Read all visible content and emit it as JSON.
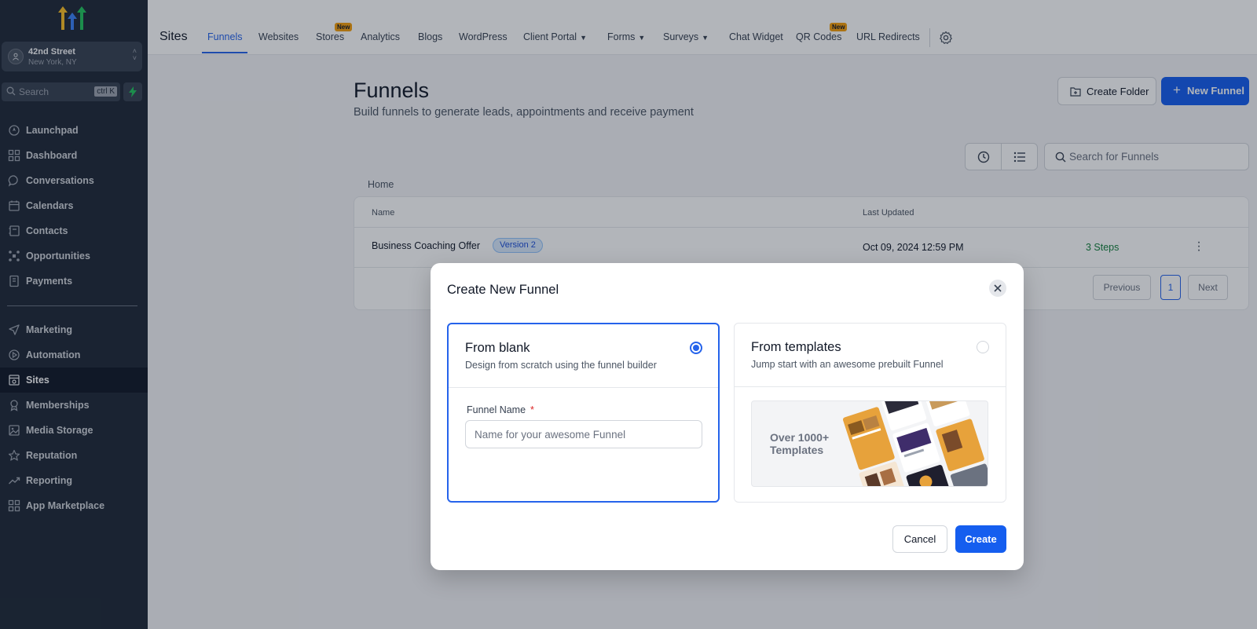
{
  "sidebar": {
    "location": {
      "name": "42nd Street",
      "city": "New York, NY"
    },
    "search": {
      "placeholder": "Search",
      "shortcut": "ctrl K"
    },
    "items": [
      {
        "label": "Launchpad",
        "icon": "launchpad-icon"
      },
      {
        "label": "Dashboard",
        "icon": "dashboard-icon"
      },
      {
        "label": "Conversations",
        "icon": "chat-icon"
      },
      {
        "label": "Calendars",
        "icon": "calendar-icon"
      },
      {
        "label": "Contacts",
        "icon": "contacts-icon"
      },
      {
        "label": "Opportunities",
        "icon": "opportunities-icon"
      },
      {
        "label": "Payments",
        "icon": "payments-icon"
      },
      {
        "label": "Marketing",
        "icon": "send-icon"
      },
      {
        "label": "Automation",
        "icon": "automation-icon"
      },
      {
        "label": "Sites",
        "icon": "sites-icon",
        "active": true
      },
      {
        "label": "Memberships",
        "icon": "award-icon"
      },
      {
        "label": "Media Storage",
        "icon": "image-icon"
      },
      {
        "label": "Reputation",
        "icon": "star-icon"
      },
      {
        "label": "Reporting",
        "icon": "trend-icon"
      },
      {
        "label": "App Marketplace",
        "icon": "grid-icon"
      }
    ]
  },
  "topbar": {
    "title": "Sites",
    "tabs": [
      {
        "label": "Funnels",
        "active": true
      },
      {
        "label": "Websites"
      },
      {
        "label": "Stores",
        "badge": "New"
      },
      {
        "label": "Analytics"
      },
      {
        "label": "Blogs"
      },
      {
        "label": "WordPress"
      },
      {
        "label": "Client Portal",
        "dropdown": true
      },
      {
        "label": "Forms",
        "dropdown": true
      },
      {
        "label": "Surveys",
        "dropdown": true
      },
      {
        "label": "Chat Widget"
      },
      {
        "label": "QR Codes",
        "badge": "New"
      },
      {
        "label": "URL Redirects"
      }
    ]
  },
  "main": {
    "title": "Funnels",
    "subtitle": "Build funnels to generate leads, appointments and receive payment",
    "create_folder_label": "Create Folder",
    "new_funnel_label": "New Funnel",
    "search_placeholder": "Search for Funnels",
    "breadcrumb": "Home",
    "table": {
      "columns": [
        "Name",
        "Last Updated"
      ],
      "rows": [
        {
          "name": "Business Coaching Offer",
          "version": "Version 2",
          "updated": "Oct 09, 2024 12:59 PM",
          "steps": "3 Steps"
        }
      ]
    },
    "pagination": {
      "previous": "Previous",
      "current": "1",
      "next": "Next"
    }
  },
  "modal": {
    "title": "Create New Funnel",
    "options": [
      {
        "title": "From blank",
        "description": "Design from scratch using the funnel builder",
        "selected": true
      },
      {
        "title": "From templates",
        "description": "Jump start with an awesome prebuilt Funnel",
        "selected": false
      }
    ],
    "field_label": "Funnel Name",
    "required_mark": "*",
    "field_value": "",
    "field_placeholder": "Name for your awesome Funnel",
    "template_preview_text": "Over 1000+ Templates",
    "cancel_label": "Cancel",
    "create_label": "Create"
  },
  "colors": {
    "accent": "#155eef",
    "sidebar_bg": "#1f2937",
    "badge": "#f59e0b",
    "steps": "#15803d"
  }
}
